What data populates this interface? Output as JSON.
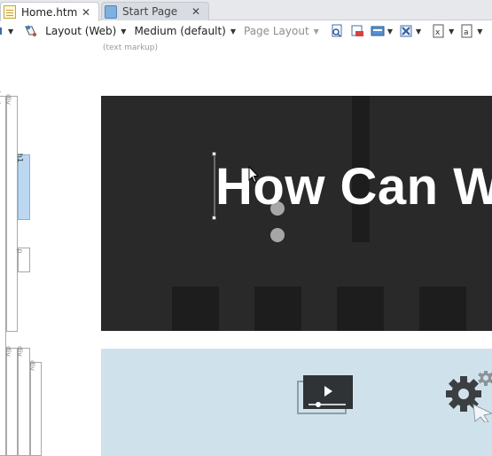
{
  "tabs": [
    {
      "label": "Home.htm",
      "close": "✕",
      "active": true,
      "icon": "document-icon"
    },
    {
      "label": "Start Page",
      "close": "✕",
      "active": false,
      "icon": "start-page-icon"
    }
  ],
  "toolbar": {
    "layout": "Layout (Web)",
    "size": "Medium (default)",
    "page_layout": "Page Layout",
    "markup_mode": "(text markup)"
  },
  "tag_tree": {
    "body": "body",
    "div": "div",
    "h1": "h1",
    "p": "p"
  },
  "canvas": {
    "heading": "How Can W"
  },
  "colors": {
    "hero_bg": "#29292a",
    "band_bg": "#cfe2ec",
    "h1_highlight": "#bcd8f0"
  }
}
